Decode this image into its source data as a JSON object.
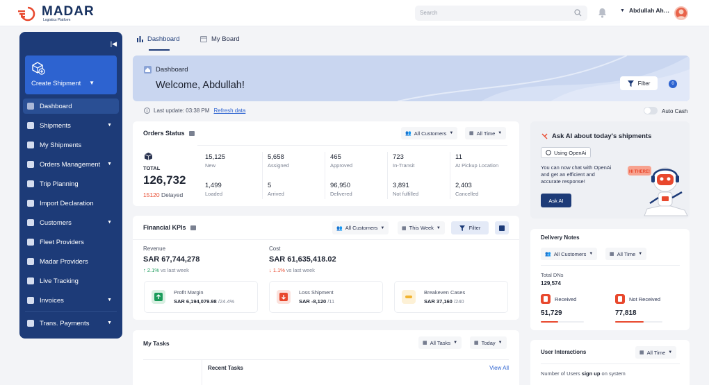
{
  "brand": {
    "name": "MADAR",
    "subtitle": "Logistics Platform"
  },
  "search": {
    "placeholder": "Search"
  },
  "user": {
    "name": "Abdullah Ahmed"
  },
  "sidebar": {
    "create_label": "Create Shipment",
    "items": [
      {
        "label": "Dashboard",
        "active": true,
        "caret": false,
        "icon": "dashboard-icon"
      },
      {
        "label": "Shipments",
        "caret": true,
        "icon": "box-icon"
      },
      {
        "label": "My Shipments",
        "caret": false,
        "icon": "box-icon"
      },
      {
        "label": "Orders Management",
        "caret": true,
        "icon": "orders-icon"
      },
      {
        "label": "Trip Planning",
        "caret": false,
        "icon": "route-icon"
      },
      {
        "label": "Import Declaration",
        "caret": false,
        "icon": "import-icon"
      },
      {
        "label": "Customers",
        "caret": true,
        "icon": "users-icon"
      },
      {
        "label": "Fleet Providers",
        "caret": false,
        "icon": "truck-icon"
      },
      {
        "label": "Madar Providers",
        "caret": false,
        "icon": "truck-icon"
      },
      {
        "label": "Live Tracking",
        "caret": false,
        "icon": "tracking-icon"
      },
      {
        "label": "Invoices",
        "caret": true,
        "icon": "invoice-icon"
      },
      {
        "label": "Trans. Payments",
        "caret": true,
        "icon": "payments-icon"
      }
    ]
  },
  "tabs": [
    {
      "label": "Dashboard"
    },
    {
      "label": "My Board"
    }
  ],
  "banner": {
    "title": "Dashboard",
    "welcome": "Welcome, Abdullah!",
    "filter_label": "Filter",
    "filter_count": "0"
  },
  "update": {
    "text": "Last update: 03:38 PM",
    "refresh": "Refresh data",
    "auto_cash": "Auto Cash"
  },
  "orders": {
    "title": "Orders Status",
    "filter_customers": "All Customers",
    "filter_time": "All Time",
    "total_label": "TOTAL",
    "total_value": "126,732",
    "delayed_value": "15120",
    "delayed_label": "Delayed",
    "stats": [
      {
        "value": "15,125",
        "label": "New"
      },
      {
        "value": "5,658",
        "label": "Assigned"
      },
      {
        "value": "465",
        "label": "Approved"
      },
      {
        "value": "723",
        "label": "In-Transit"
      },
      {
        "value": "11",
        "label": "At Pickup Location"
      },
      {
        "value": "1,499",
        "label": "Loaded"
      },
      {
        "value": "5",
        "label": "Arrived"
      },
      {
        "value": "96,950",
        "label": "Delivered"
      },
      {
        "value": "3,891",
        "label": "Not fulfilled"
      },
      {
        "value": "2,403",
        "label": "Cancelled"
      }
    ]
  },
  "financial": {
    "title": "Financial KPIs",
    "filter_customers": "All Customers",
    "filter_period": "This Week",
    "filter_label": "Filter",
    "revenue_label": "Revenue",
    "revenue_value": "SAR 67,744,278",
    "revenue_change": "2.1%",
    "revenue_change_label": "vs last week",
    "cost_label": "Cost",
    "cost_value": "SAR 61,635,418.02",
    "cost_change": "1.1%",
    "cost_change_label": "vs last week",
    "kpis": [
      {
        "name": "Profit Margin",
        "value": "SAR 6,194,079.98",
        "extra": "/24.4%"
      },
      {
        "name": "Loss Shipment",
        "value": "SAR -8,120",
        "extra": "/11"
      },
      {
        "name": "Breakeven Cases",
        "value": "SAR 37,160",
        "extra": "/240"
      }
    ]
  },
  "tasks": {
    "title": "My Tasks",
    "filter_tasks": "All Tasks",
    "filter_period": "Today",
    "recent": "Recent Tasks",
    "view_all": "View All"
  },
  "ai": {
    "title": "Ask AI about today's shipments",
    "chip": "Using OpenAi",
    "text": "You can now chat with OpenAi and get an efficient and accurate response!",
    "button": "Ask AI",
    "bubble": "HI THERE!"
  },
  "delivery": {
    "title": "Delivery Notes",
    "filter_customers": "All Customers",
    "filter_time": "All Time",
    "total_label": "Total DNs",
    "total_value": "129,574",
    "received_label": "Received",
    "received_value": "51,729",
    "received_fraction": 0.4,
    "not_received_label": "Not Received",
    "not_received_value": "77,818",
    "not_received_fraction": 0.6
  },
  "interactions": {
    "title": "User Interactions",
    "filter_time": "All Time",
    "text_pre": "Number of Users",
    "text_bold": "sign up",
    "text_post": "on system"
  },
  "colors": {
    "primary": "#1d3b78",
    "accent": "#2d63d0",
    "danger": "#e8482d",
    "success": "#1a9b5a"
  }
}
